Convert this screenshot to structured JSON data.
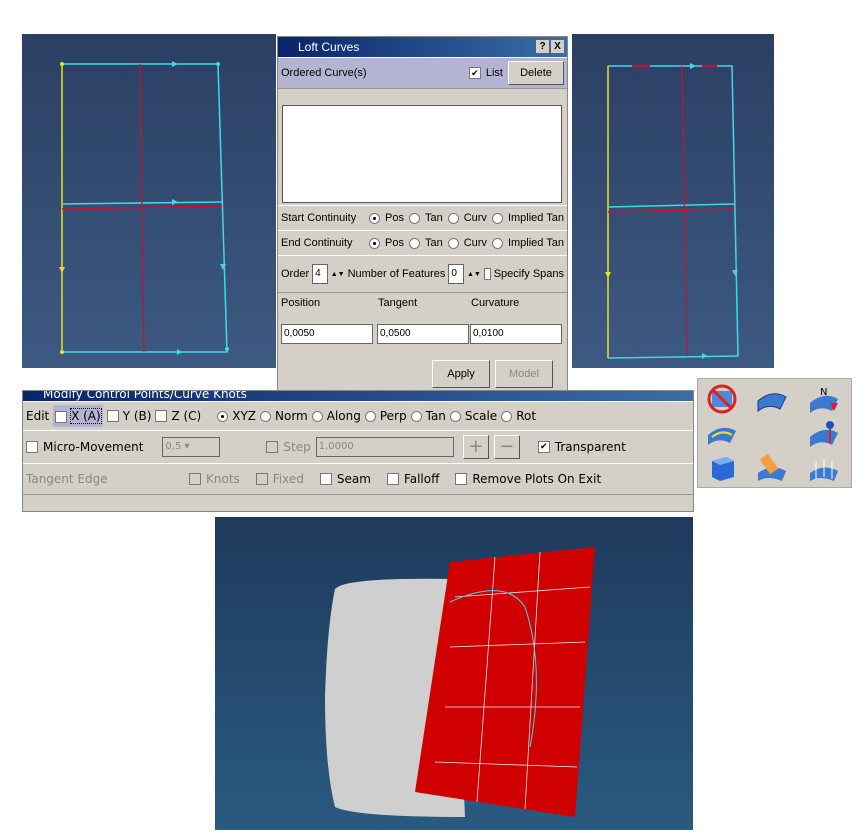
{
  "loft": {
    "title": "Loft Curves",
    "help": "?",
    "close": "X",
    "ordered_label": "Ordered Curve(s)",
    "list_label": "List",
    "list_checked": true,
    "delete": "Delete",
    "start_label": "Start Continuity",
    "end_label": "End Continuity",
    "opts": [
      "Pos",
      "Tan",
      "Curv",
      "Implied Tan"
    ],
    "start_selected": "Pos",
    "end_selected": "Pos",
    "order_label": "Order",
    "order_value": "4",
    "features_label": "Number of Features",
    "features_value": "0",
    "spans_label": "Specify Spans",
    "position_label": "Position",
    "tangent_label": "Tangent",
    "curvature_label": "Curvature",
    "position_value": "0,0050",
    "tangent_value": "0,0500",
    "curvature_value": "0,0100",
    "apply": "Apply",
    "model": "Model"
  },
  "modify": {
    "title": "Modify Control Points/Curve Knots",
    "edit_label": "Edit",
    "axes": [
      "X (A)",
      "Y (B)",
      "Z (C)"
    ],
    "modes": [
      "XYZ",
      "Norm",
      "Along",
      "Perp",
      "Tan",
      "Scale",
      "Rot"
    ],
    "mode_selected": "XYZ",
    "micro_label": "Micro-Movement",
    "micro_value": "0,5",
    "step_label": "Step",
    "step_value": "1,0000",
    "plus": "+",
    "minus": "−",
    "transparent_label": "Transparent",
    "transparent_checked": true,
    "tangent_edge": "Tangent Edge",
    "knots": "Knots",
    "fixed": "Fixed",
    "seam": "Seam",
    "falloff": "Falloff",
    "remove_plots": "Remove Plots On Exit"
  },
  "icons": [
    "no-render-icon",
    "surface-icon",
    "normal-flip-icon",
    "curvature-surface-icon",
    "surface-edit-icon",
    "cube-icon",
    "eraser-icon",
    "knots-icon"
  ],
  "colors": {
    "viewport": "#2f4770",
    "curve_cyan": "#3fd8e8",
    "curve_red": "#c8102e",
    "curve_yellow": "#f0e020",
    "mesh_red": "#d00000"
  }
}
